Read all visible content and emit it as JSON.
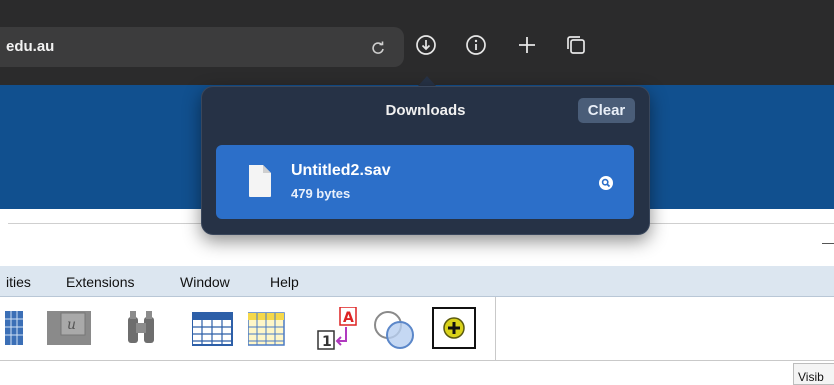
{
  "browser": {
    "url_text": "edu.au",
    "icons": [
      "reload-icon",
      "downloads-icon",
      "info-icon",
      "new-tab-icon",
      "tab-overview-icon"
    ]
  },
  "downloads": {
    "title": "Downloads",
    "clear_label": "Clear",
    "items": [
      {
        "name": "Untitled2.sav",
        "size": "479 bytes",
        "icon": "document-icon",
        "action_icon": "magnifier-reveal-icon"
      }
    ]
  },
  "app": {
    "menu": [
      "ities",
      "Extensions",
      "Window",
      "Help"
    ],
    "toolbar_icons": [
      "data-view-icon",
      "variable-u-icon",
      "binoculars-find-icon",
      "grid-table-icon",
      "yellow-table-icon",
      "value-labels-a1-icon",
      "use-sets-circles-icon",
      "add-extension-icon"
    ],
    "visible_tab": "Visib"
  },
  "colors": {
    "toolbar_bg": "#2b2b2c",
    "banner_blue": "#11508f",
    "popover_bg": "#263246",
    "selected_item": "#2c6fc9",
    "menubar_bg": "#dce6f0"
  }
}
